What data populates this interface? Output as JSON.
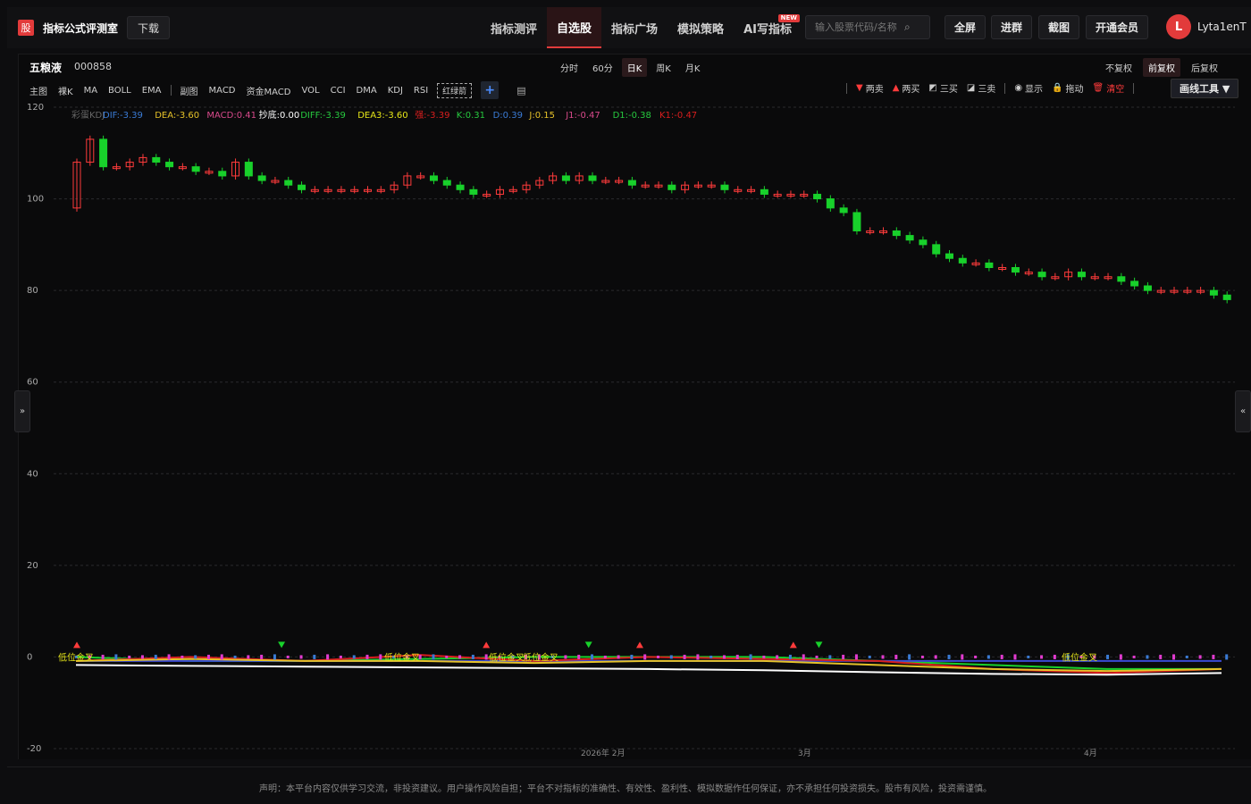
{
  "header": {
    "logo_glyph": "股",
    "brand": "指标公式评测室",
    "download": "下载",
    "nav": [
      {
        "label": "指标测评",
        "active": false
      },
      {
        "label": "自选股",
        "active": true
      },
      {
        "label": "指标广场",
        "active": false
      },
      {
        "label": "模拟策略",
        "active": false
      },
      {
        "label": "AI写指标",
        "active": false,
        "badge": "NEW"
      }
    ],
    "search_placeholder": "输入股票代码/名称",
    "buttons": [
      "全屏",
      "进群",
      "截图",
      "开通会员"
    ],
    "avatar_letter": "L",
    "username": "Lyta1enT"
  },
  "stock": {
    "name": "五粮液",
    "code": "000858"
  },
  "periods": [
    {
      "label": "分时",
      "active": false
    },
    {
      "label": "60分",
      "active": false
    },
    {
      "label": "日K",
      "active": true
    },
    {
      "label": "周K",
      "active": false
    },
    {
      "label": "月K",
      "active": false
    }
  ],
  "adjust": [
    {
      "label": "不复权",
      "active": false
    },
    {
      "label": "前复权",
      "active": true
    },
    {
      "label": "后复权",
      "active": false
    }
  ],
  "indicators_main": [
    "主图",
    "裸K",
    "MA",
    "BOLL",
    "EMA"
  ],
  "indicators_sub": [
    "副图",
    "MACD",
    "资金MACD",
    "VOL",
    "CCI",
    "DMA",
    "KDJ",
    "RSI"
  ],
  "indicator_custom": "红绿箭",
  "tools": [
    {
      "label": "两卖",
      "icon": "down-triangle-icon",
      "glyph": "▼",
      "color": "#ff3b3b"
    },
    {
      "label": "两买",
      "icon": "up-triangle-icon",
      "glyph": "▲",
      "color": "#ff3b3b"
    },
    {
      "label": "三买",
      "icon": "trend-up-icon",
      "glyph": "◩",
      "color": "#cccccc"
    },
    {
      "label": "三卖",
      "icon": "trend-down-icon",
      "glyph": "◪",
      "color": "#cccccc"
    },
    {
      "label": "显示",
      "icon": "eye-icon",
      "glyph": "◉",
      "color": "#cccccc"
    },
    {
      "label": "拖动",
      "icon": "lock-icon",
      "glyph": "🔒",
      "color": "#cccccc"
    },
    {
      "label": "清空",
      "icon": "trash-icon",
      "glyph": "🗑",
      "color": "#ff3b3b"
    }
  ],
  "draw_tools": "画线工具 ▼",
  "legend": [
    {
      "text": "彩蛋KDJ",
      "color": "#666666"
    },
    {
      "text": "DIF:-3.39",
      "color": "#3a7bd5"
    },
    {
      "text": "DEA:-3.60",
      "color": "#e6c229"
    },
    {
      "text": "MACD:0.41",
      "color": "#d94a8c"
    },
    {
      "text": "抄底:0.00",
      "color": "#ffffff"
    },
    {
      "text": "DIFF:-3.39",
      "color": "#27c93f"
    },
    {
      "text": "DEA3:-3.60",
      "color": "#e6e619"
    },
    {
      "text": "强:-3.39",
      "color": "#d81e1e"
    },
    {
      "text": "K:0.31",
      "color": "#27c93f"
    },
    {
      "text": "D:0.39",
      "color": "#3a7bd5"
    },
    {
      "text": "J:0.15",
      "color": "#e6c229"
    },
    {
      "text": "J1:-0.47",
      "color": "#d94a8c"
    },
    {
      "text": "D1:-0.38",
      "color": "#27c93f"
    },
    {
      "text": "K1:-0.47",
      "color": "#d81e1e"
    }
  ],
  "chart_data": {
    "type": "candlestick",
    "ylim": [
      -20,
      120
    ],
    "yticks": [
      120,
      100,
      80,
      60,
      40,
      20,
      0,
      -20
    ],
    "xtick_labels": [
      "2026年 2月",
      "3月",
      "4月"
    ],
    "candles_close_approx": [
      108,
      113,
      107,
      107,
      108,
      109,
      108,
      107,
      107,
      106,
      106,
      105,
      108,
      105,
      104,
      104,
      103,
      102,
      102,
      102,
      102,
      102,
      102,
      102,
      103,
      105,
      105,
      104,
      103,
      102,
      101,
      101,
      102,
      102,
      103,
      104,
      105,
      104,
      105,
      104,
      104,
      104,
      103,
      103,
      103,
      102,
      103,
      103,
      103,
      102,
      102,
      102,
      101,
      101,
      101,
      101,
      100,
      98,
      97,
      93,
      93,
      93,
      92,
      91,
      90,
      88,
      87,
      86,
      86,
      85,
      85,
      84,
      84,
      83,
      83,
      84,
      83,
      83,
      83,
      82,
      81,
      80,
      80,
      80,
      80,
      80,
      79,
      78
    ],
    "labels_on_chart": [
      "低位金叉",
      "低位金叉",
      "低位金叉",
      "低位金叉",
      "低位金叉"
    ]
  },
  "disclaimer": "声明：本平台内容仅供学习交流，非投资建议。用户操作风险自担；平台不对指标的准确性、有效性、盈利性、模拟数据作任何保证，亦不承担任何投资损失。股市有风险，投资需谨慎。"
}
